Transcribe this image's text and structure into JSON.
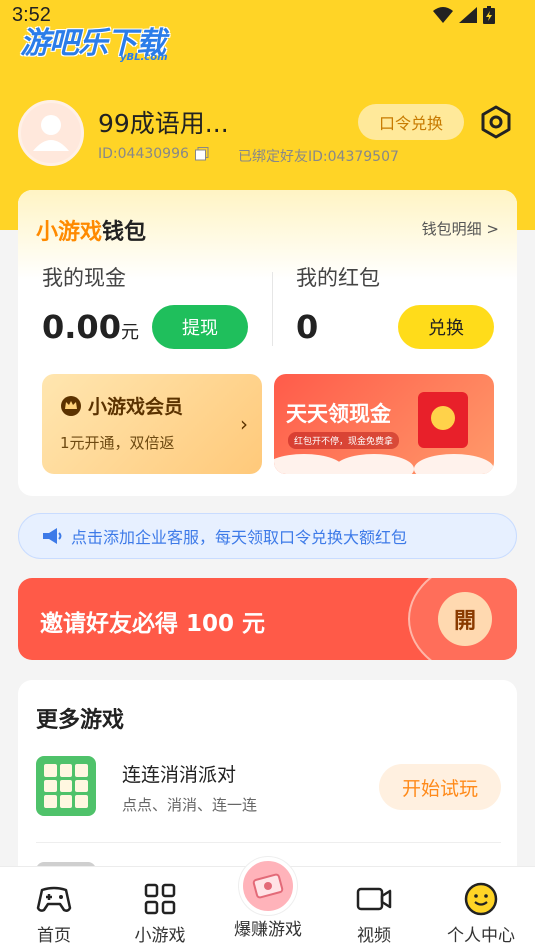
{
  "status": {
    "time": "3:52"
  },
  "logo": {
    "text": "游吧乐下载",
    "sub": "yBL.com"
  },
  "profile": {
    "username": "99成语用...",
    "id_text": "ID:04430996",
    "bound_text": "已绑定好友ID:04379507",
    "code_button": "口令兑换"
  },
  "wallet": {
    "title_highlight": "小游戏",
    "title_rest": "钱包",
    "detail_link": "钱包明细 >",
    "cash_label": "我的现金",
    "cash_value": "0.00",
    "cash_unit": "元",
    "withdraw_button": "提现",
    "redpack_label": "我的红包",
    "redpack_value": "0",
    "exchange_button": "兑换",
    "vip_title": "小游戏会员",
    "vip_sub": "1元开通，双倍返",
    "daily_title": "天天领现金",
    "daily_sub": "红包开不停，现金免费拿"
  },
  "notice": {
    "text": "点击添加企业客服，每天领取口令兑换大额红包"
  },
  "invite": {
    "text": "邀请好友必得 100 元",
    "open_label": "開"
  },
  "more_games": {
    "title": "更多游戏",
    "items": [
      {
        "name": "连连消消派对",
        "desc": "点点、消消、连一连",
        "button": "开始试玩"
      }
    ]
  },
  "nav": {
    "items": [
      {
        "label": "首页"
      },
      {
        "label": "小游戏"
      },
      {
        "label": "爆赚游戏"
      },
      {
        "label": "视频"
      },
      {
        "label": "个人中心"
      }
    ]
  },
  "colors": {
    "brand_yellow": "#ffd426",
    "green_button": "#1fbf5c",
    "invite_red": "#ff5a48",
    "accent_orange": "#ff8a00"
  }
}
